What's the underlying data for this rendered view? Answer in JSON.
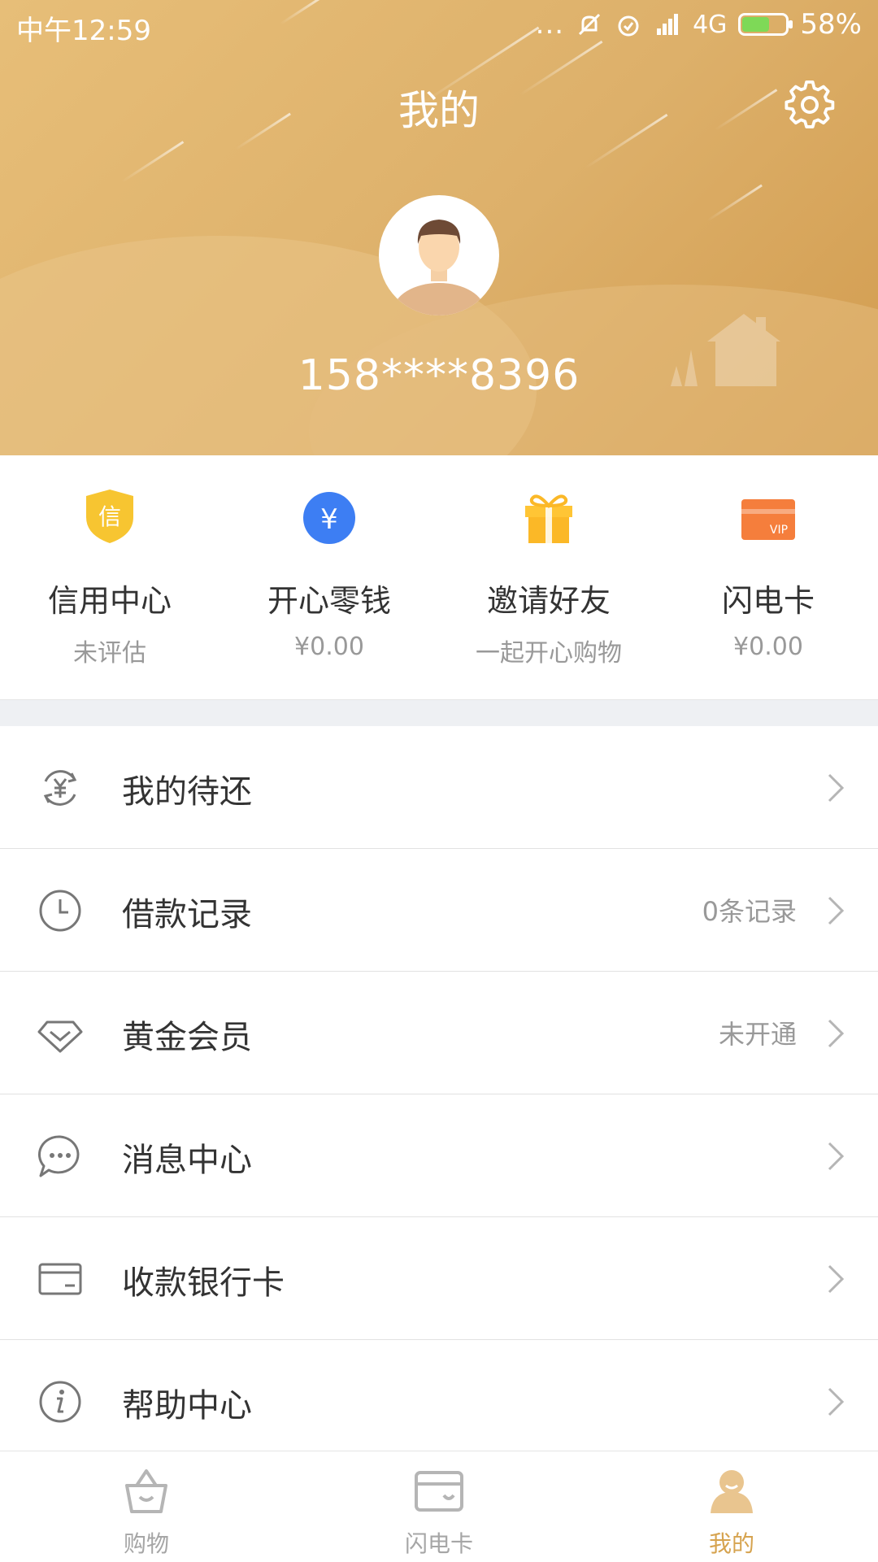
{
  "status_bar": {
    "time": "中午12:59",
    "dots": "...",
    "network": "4G",
    "battery": "58%",
    "battery_level": 0.58
  },
  "header": {
    "title": "我的",
    "phone": "158****8396"
  },
  "quick_actions": [
    {
      "label": "信用中心",
      "sub": "未评估",
      "icon": "credit-shield-icon",
      "icon_text": "信"
    },
    {
      "label": "开心零钱",
      "sub": "¥0.00",
      "icon": "yuan-coin-icon",
      "icon_text": "¥"
    },
    {
      "label": "邀请好友",
      "sub": "一起开心购物",
      "icon": "gift-icon"
    },
    {
      "label": "闪电卡",
      "sub": "¥0.00",
      "icon": "vip-card-icon",
      "icon_text": "VIP"
    }
  ],
  "menu": [
    {
      "label": "我的待还",
      "value": "",
      "icon": "yuan-cycle-icon"
    },
    {
      "label": "借款记录",
      "value": "0条记录",
      "icon": "clock-icon"
    },
    {
      "label": "黄金会员",
      "value": "未开通",
      "icon": "diamond-icon"
    },
    {
      "label": "消息中心",
      "value": "",
      "icon": "chat-bubble-icon"
    },
    {
      "label": "收款银行卡",
      "value": "",
      "icon": "bank-card-icon"
    },
    {
      "label": "帮助中心",
      "value": "",
      "icon": "info-icon"
    }
  ],
  "bottom_nav": [
    {
      "label": "购物",
      "icon": "basket-icon",
      "active": false
    },
    {
      "label": "闪电卡",
      "icon": "card-icon",
      "active": false
    },
    {
      "label": "我的",
      "icon": "user-icon",
      "active": true
    }
  ],
  "colors": {
    "accent": "#d6a34f",
    "header_gradient_start": "#e7be78",
    "header_gradient_end": "#d29c4f",
    "shield_yellow": "#f7c531",
    "coin_blue": "#3d7ef3",
    "gift_orange": "#fbb827",
    "vip_orange": "#f57e3c"
  }
}
